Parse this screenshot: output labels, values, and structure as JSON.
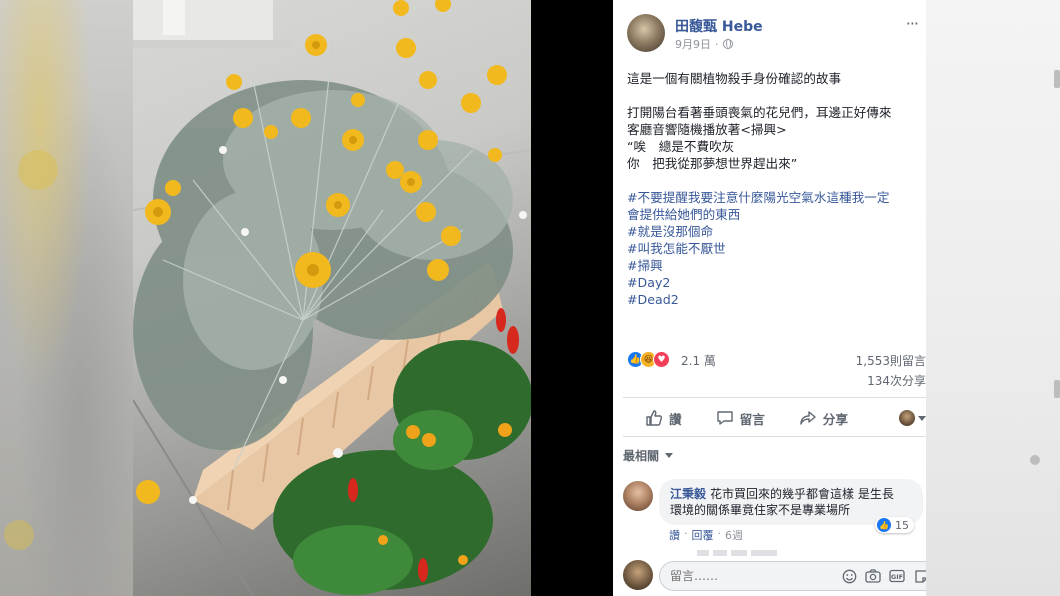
{
  "post": {
    "author": "田馥甄 Hebe",
    "date": "9月9日",
    "more_icon": "···",
    "text_lines": [
      "這是一個有關植物殺手身份確認的故事",
      "打開陽台看著垂頭喪氣的花兒們，耳邊正好傳來",
      "客廳音響隨機播放著<掃興>",
      "“唉　總是不費吹灰",
      "你　把我從那夢想世界趕出來”"
    ],
    "hashtags": [
      "#不要提醒我要注意什麼陽光空氣水這種我一定",
      "會提供給她們的東西",
      "#就是沒那個命",
      "#叫我怎能不厭世",
      "#掃興",
      "#Day2",
      "#Dead2"
    ]
  },
  "stats": {
    "reactions": "2.1 萬",
    "comments": "1,553則留言",
    "shares": "134次分享",
    "reaction_icons": [
      "like-icon",
      "haha-icon",
      "love-icon"
    ]
  },
  "actions": {
    "like": "讚",
    "comment": "留言",
    "share": "分享"
  },
  "comments_section": {
    "sort_label": "最相關",
    "items": [
      {
        "name": "江秉毅",
        "text_line1": "花市買回來的幾乎都會這樣 是生長",
        "text_line2": "環境的關係畢竟住家不是專業場所",
        "likes": "15",
        "like_action": "讚",
        "reply_action": "回覆",
        "time": "6週"
      }
    ],
    "compose_placeholder": "留言……"
  },
  "colors": {
    "link": "#385898",
    "text": "#1d2129",
    "muted": "#606770",
    "like_blue": "#1877f2",
    "flower_yellow": "#f2b91e"
  }
}
